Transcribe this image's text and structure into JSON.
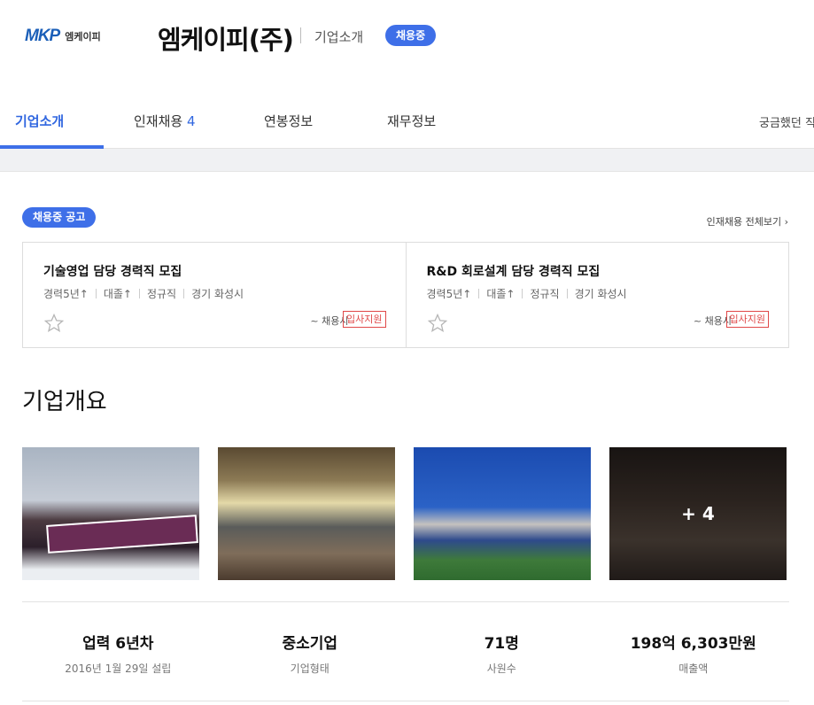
{
  "header": {
    "logo_mark": "MKP",
    "logo_text": "엠케이피",
    "company_name": "엠케이피(주)",
    "about_link": "기업소개",
    "hiring_badge": "채용중"
  },
  "tabs": [
    {
      "label": "기업소개",
      "active": true
    },
    {
      "label": "인재채용",
      "count": "4"
    },
    {
      "label": "연봉정보"
    },
    {
      "label": "재무정보"
    }
  ],
  "tab_more": "궁금했던 직",
  "jobs": {
    "badge": "채용중 공고",
    "view_all": "인재채용 전체보기",
    "items": [
      {
        "title": "기술영업 담당 경력직 모집",
        "meta": [
          "경력5년↑",
          "대졸↑",
          "정규직",
          "경기 화성시"
        ],
        "deadline": "~ 채용시",
        "apply": "입사지원"
      },
      {
        "title": "R&D 회로설계 담당 경력직 모집",
        "meta": [
          "경력5년↑",
          "대졸↑",
          "정규직",
          "경기 화성시"
        ],
        "deadline": "~ 채용시",
        "apply": "입사지원"
      }
    ]
  },
  "overview": {
    "title": "기업개요",
    "photo_more": "+ 4",
    "stats": [
      {
        "value": "업력 6년차",
        "label": "2016년 1월 29일 설립"
      },
      {
        "value": "중소기업",
        "label": "기업형태"
      },
      {
        "value": "71명",
        "label": "사원수"
      },
      {
        "value": "198억 6,303만원",
        "label": "매출액"
      }
    ]
  },
  "colors": {
    "accent": "#3e6fe8",
    "apply": "#e04848"
  }
}
